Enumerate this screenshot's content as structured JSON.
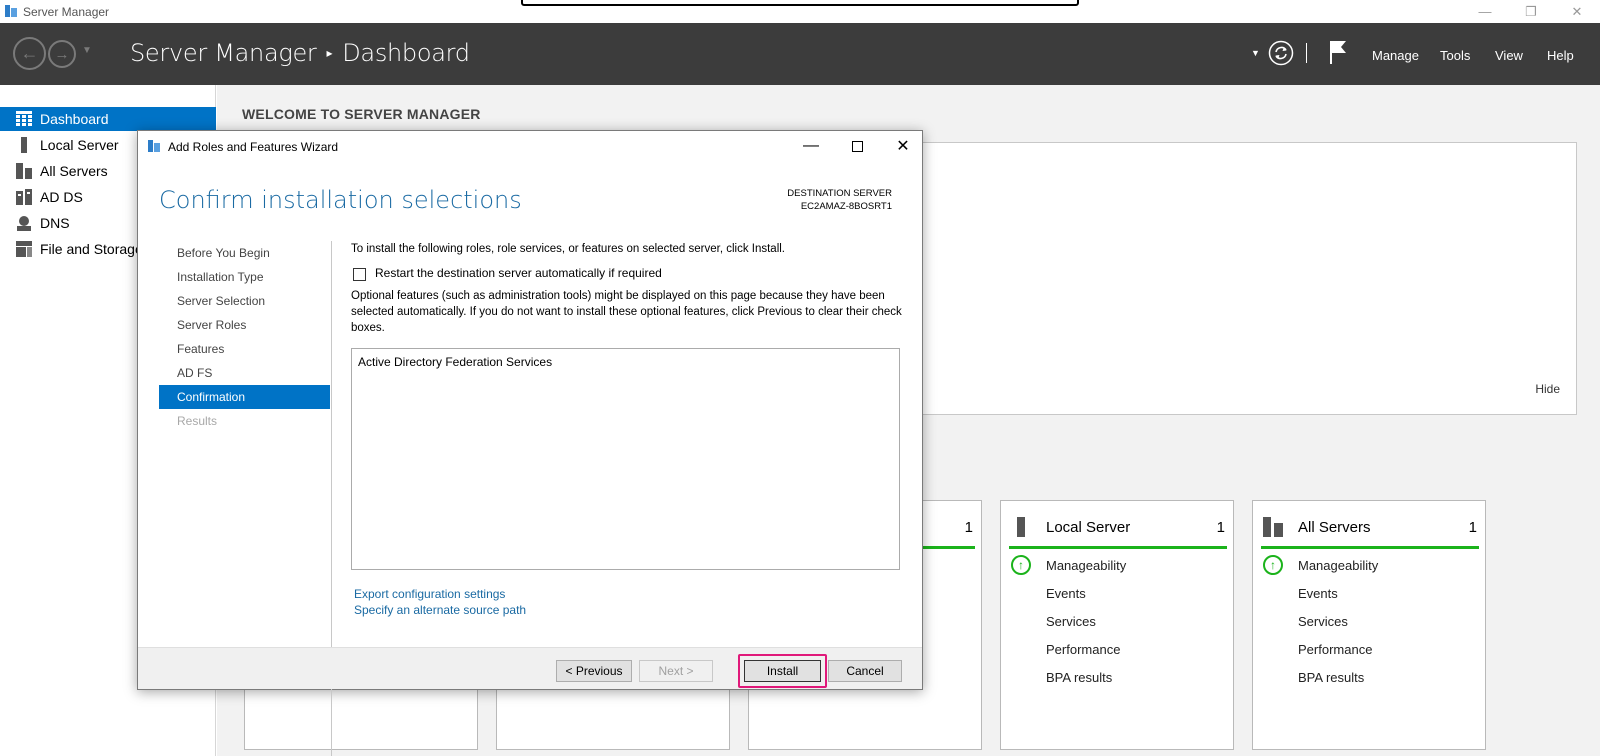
{
  "window": {
    "title": "Server Manager",
    "minimize_glyph": "—",
    "restore_glyph": "❐",
    "close_glyph": "✕"
  },
  "header": {
    "app_name": "Server Manager",
    "separator": "▸",
    "page": "Dashboard",
    "menus": [
      "Manage",
      "Tools",
      "View",
      "Help"
    ]
  },
  "sidebar": {
    "items": [
      {
        "label": "Dashboard",
        "icon": "dashboard-grid-icon",
        "active": true
      },
      {
        "label": "Local Server",
        "icon": "server-icon"
      },
      {
        "label": "All Servers",
        "icon": "servers-icon"
      },
      {
        "label": "AD DS",
        "icon": "ad-ds-icon"
      },
      {
        "label": "DNS",
        "icon": "dns-icon"
      },
      {
        "label": "File and Storage",
        "icon": "file-storage-icon"
      }
    ]
  },
  "main": {
    "welcome": "WELCOME TO SERVER MANAGER",
    "hide": "Hide",
    "tiles": [
      {
        "name": "",
        "count": "",
        "rows": []
      },
      {
        "name": "",
        "count": "",
        "rows": []
      },
      {
        "name": "",
        "count": "1",
        "rows": []
      },
      {
        "name": "Local Server",
        "count": "1",
        "rows": [
          "Manageability",
          "Events",
          "Services",
          "Performance",
          "BPA results"
        ]
      },
      {
        "name": "All Servers",
        "count": "1",
        "rows": [
          "Manageability",
          "Events",
          "Services",
          "Performance",
          "BPA results"
        ]
      }
    ]
  },
  "wizard": {
    "title": "Add Roles and Features Wizard",
    "heading": "Confirm installation selections",
    "destination_label": "DESTINATION SERVER",
    "destination_server": "EC2AMAZ-8BOSRT1",
    "steps": [
      {
        "label": "Before You Begin",
        "state": "normal"
      },
      {
        "label": "Installation Type",
        "state": "normal"
      },
      {
        "label": "Server Selection",
        "state": "normal"
      },
      {
        "label": "Server Roles",
        "state": "normal"
      },
      {
        "label": "Features",
        "state": "normal"
      },
      {
        "label": "AD FS",
        "state": "normal"
      },
      {
        "label": "Confirmation",
        "state": "active"
      },
      {
        "label": "Results",
        "state": "disabled"
      }
    ],
    "intro": "To install the following roles, role services, or features on selected server, click Install.",
    "restart_checkbox_label": "Restart the destination server automatically if required",
    "restart_checked": false,
    "optional_text": "Optional features (such as administration tools) might be displayed on this page because they have been selected automatically. If you do not want to install these optional features, click Previous to clear their check boxes.",
    "selected_items": [
      "Active Directory Federation Services"
    ],
    "links": [
      "Export configuration settings",
      "Specify an alternate source path"
    ],
    "buttons": {
      "previous": "< Previous",
      "next": "Next >",
      "install": "Install",
      "cancel": "Cancel"
    }
  },
  "colors": {
    "accent": "#0073c6",
    "header_bg": "#3c3c3c",
    "status_green": "#1bb31b",
    "highlight": "#e0197a",
    "link": "#1a6aa3"
  }
}
